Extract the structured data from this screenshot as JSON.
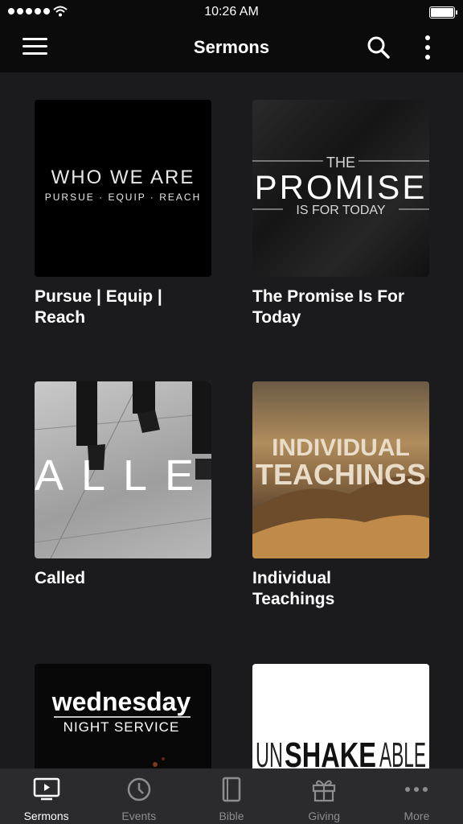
{
  "status_bar": {
    "time": "10:26 AM"
  },
  "nav": {
    "title": "Sermons"
  },
  "sermons": [
    {
      "title": "Pursue | Equip | Reach",
      "art_line1": "WHO WE ARE",
      "art_line2": "PURSUE · EQUIP · REACH"
    },
    {
      "title": "The Promise Is For Today",
      "art_line1": "THE",
      "art_line2": "PROMISE",
      "art_line3": "IS FOR TODAY"
    },
    {
      "title": "Called",
      "art_line1": "ALLE"
    },
    {
      "title": "Individual Teachings",
      "art_line1": "INDIVIDUAL",
      "art_line2": "TEACHINGS"
    },
    {
      "title": "",
      "art_line1": "wednesday",
      "art_line2": "NIGHT SERVICE"
    },
    {
      "title": "",
      "art_line1": "UN",
      "art_line2": "SHAKE",
      "art_line3": "ABLE"
    }
  ],
  "tabs": [
    {
      "label": "Sermons",
      "icon": "video-icon"
    },
    {
      "label": "Events",
      "icon": "clock-icon"
    },
    {
      "label": "Bible",
      "icon": "book-icon"
    },
    {
      "label": "Giving",
      "icon": "gift-icon"
    },
    {
      "label": "More",
      "icon": "ellipsis-icon"
    }
  ],
  "colors": {
    "background": "#1b1b1d",
    "bar": "#0b0b0b",
    "tabbar": "#2b2b2d",
    "tab_inactive": "#8d8d90"
  }
}
